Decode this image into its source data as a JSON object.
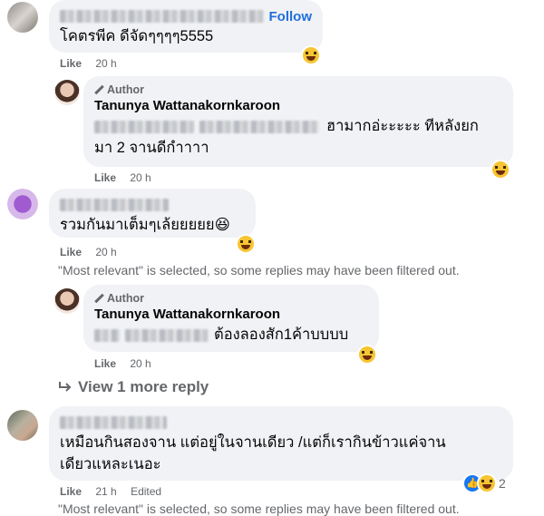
{
  "comments": [
    {
      "id": "c1",
      "follow_label": "Follow",
      "text": "โคตรพีค ดีจัดๆๆๆๆ5555",
      "like_label": "Like",
      "time": "20 h"
    },
    {
      "id": "r1",
      "author_badge": "Author",
      "name": "Tanunya Wattanakornkaroon",
      "text_line1": "ฮามากอ่ะะะะะ ทีหลังยก",
      "text_line2": "มา 2 จานดีกำาาา",
      "like_label": "Like",
      "time": "20 h"
    },
    {
      "id": "c2",
      "text": "รวมกันมาเต็มๆเล้ยยยยย😆",
      "like_label": "Like",
      "time": "20 h"
    },
    {
      "id": "r2",
      "author_badge": "Author",
      "name": "Tanunya Wattanakornkaroon",
      "text": "ต้องลองสัก1ค้าบบบบ",
      "like_label": "Like",
      "time": "20 h"
    },
    {
      "id": "c3",
      "text_line1": "เหมือนกินสองจาน แต่อยู่ในจานเดียว /แต่ก็เรากินข้าวแค่จาน",
      "text_line2": "เดียวแหละเนอะ",
      "like_label": "Like",
      "time": "21 h",
      "edited_label": "Edited",
      "reaction_count": "2"
    }
  ],
  "filter_notice_1": "\"Most relevant\" is selected, so some replies may have been filtered out.",
  "filter_notice_2": "\"Most relevant\" is selected, so some replies may have been filtered out.",
  "view_more_label": "View 1 more reply",
  "icons": {
    "reply_arrow": "reply-arrow-icon",
    "pencil": "pencil-icon",
    "reaction_haha": "haha-reaction-icon",
    "reaction_like": "like-reaction-icon"
  },
  "colors": {
    "bubble": "#f0f2f5",
    "link": "#216fdb",
    "muted": "#65676b",
    "haha": "#f7c533",
    "like": "#1877f2"
  }
}
